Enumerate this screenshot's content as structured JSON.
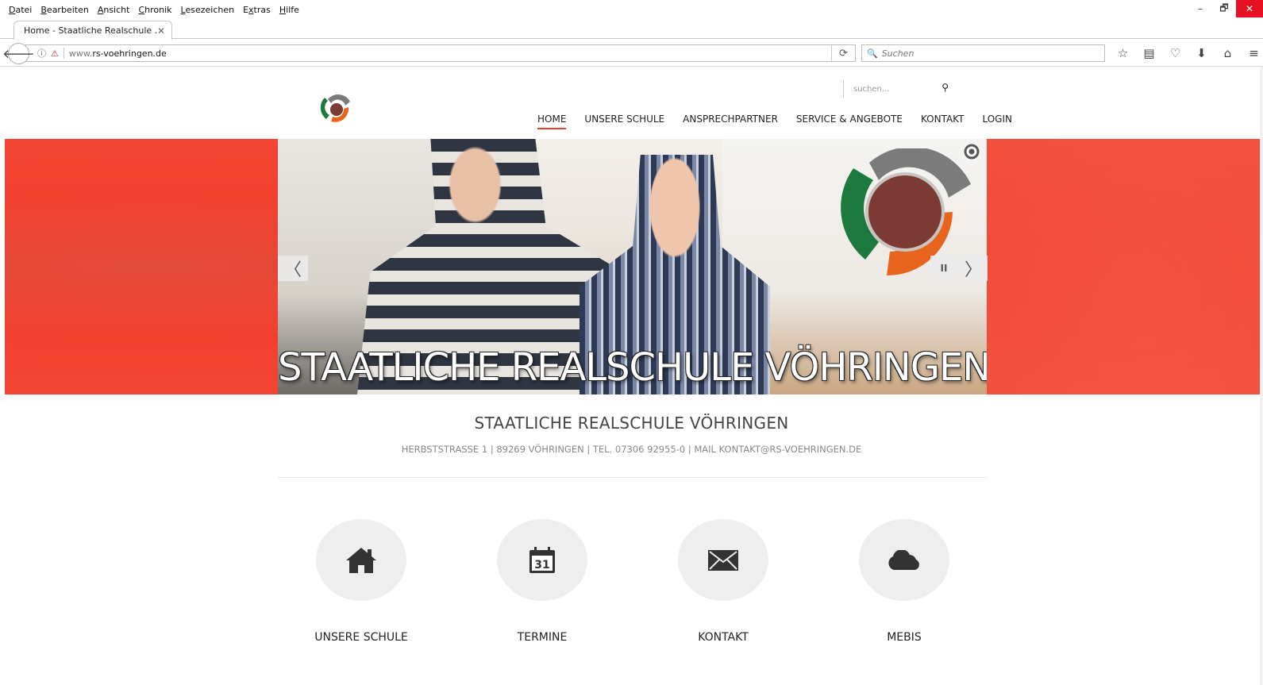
{
  "menubar": {
    "items": [
      {
        "pre": "",
        "key": "D",
        "rest": "atei"
      },
      {
        "pre": "",
        "key": "B",
        "rest": "earbeiten"
      },
      {
        "pre": "",
        "key": "A",
        "rest": "nsicht"
      },
      {
        "pre": "",
        "key": "C",
        "rest": "hronik"
      },
      {
        "pre": "",
        "key": "L",
        "rest": "esezeichen"
      },
      {
        "pre": "E",
        "key": "x",
        "rest": "tras"
      },
      {
        "pre": "",
        "key": "H",
        "rest": "ilfe"
      }
    ]
  },
  "window_controls": {
    "minimize": "–",
    "restore": "🗗",
    "close": "✕"
  },
  "tab": {
    "title": "Home - Staatliche Realschule ...",
    "close": "✕",
    "new": "+"
  },
  "urlbar": {
    "prefix": "www.",
    "host": "rs-voehringen.de",
    "reload": "C"
  },
  "searchbar": {
    "placeholder": "Suchen"
  },
  "site": {
    "search_placeholder": "suchen...",
    "nav": [
      {
        "label": "HOME",
        "active": true
      },
      {
        "label": "UNSERE SCHULE",
        "active": false
      },
      {
        "label": "ANSPRECHPARTNER",
        "active": false
      },
      {
        "label": "SERVICE & ANGEBOTE",
        "active": false
      },
      {
        "label": "KONTAKT",
        "active": false
      },
      {
        "label": "LOGIN",
        "active": false
      }
    ],
    "slide_title": "STAATLICHE REALSCHULE VÖHRINGEN",
    "slide_prev": "〈",
    "slide_pause": "II",
    "slide_next": "〉",
    "school_title": "STAATLICHE REALSCHULE VÖHRINGEN",
    "address": "HERBSTSTRASSE 1 | 89269 VÖHRINGEN | TEL. 07306 92955-0 | MAIL KONTAKT@RS-VOEHRINGEN.DE",
    "features": [
      {
        "label": "UNSERE SCHULE",
        "icon": "home-icon"
      },
      {
        "label": "TERMINE",
        "icon": "calendar-icon",
        "day": "31"
      },
      {
        "label": "KONTAKT",
        "icon": "envelope-icon"
      },
      {
        "label": "MEBIS",
        "icon": "cloud-icon"
      }
    ]
  },
  "colors": {
    "accent": "#e23d28",
    "hero_bg": "#f2402f",
    "logo_green": "#1c7a3e",
    "logo_orange": "#e8641e",
    "logo_gray": "#7b7b7b",
    "logo_core": "#7b3a33"
  }
}
